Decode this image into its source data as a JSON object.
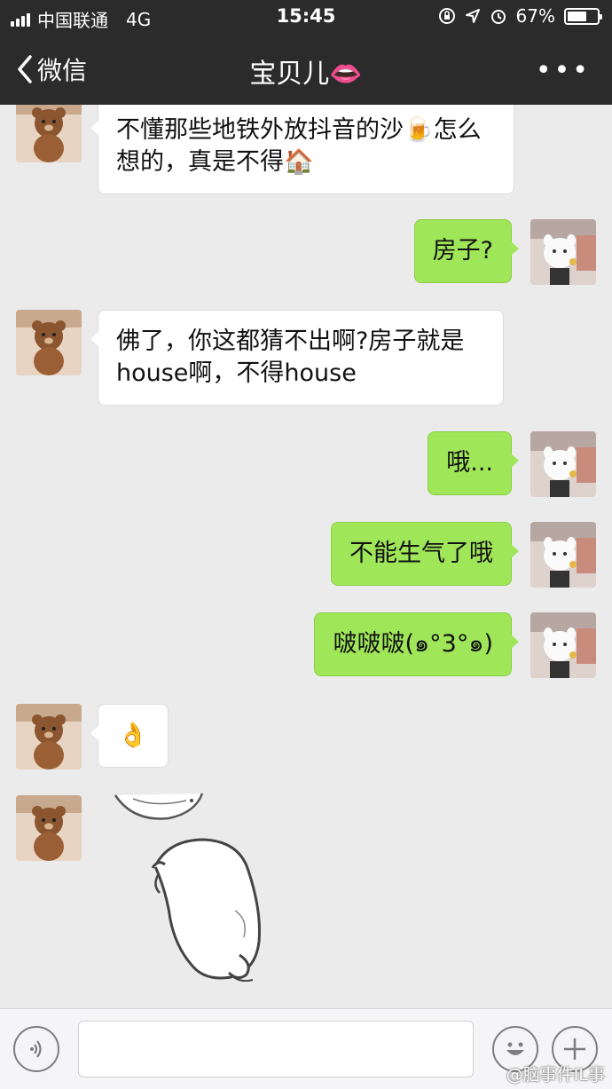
{
  "status_bar": {
    "carrier": "中国联通",
    "network": "4G",
    "time": "15:45",
    "battery_percent_text": "67%",
    "battery_level": 0.67
  },
  "nav": {
    "back_label": "微信",
    "title": "宝贝儿👄",
    "more_label": "•••"
  },
  "messages": [
    {
      "side": "in",
      "text": "不懂那些地铁外放抖音的沙🍺怎么想的，真是不得🏠"
    },
    {
      "side": "out",
      "text": "房子?"
    },
    {
      "side": "in",
      "text": "佛了，你这都猜不出啊?房子就是house啊，不得house"
    },
    {
      "side": "out",
      "text": "哦..."
    },
    {
      "side": "out",
      "text": "不能生气了哦"
    },
    {
      "side": "out",
      "text": "啵啵啵(๑°3°๑)"
    },
    {
      "side": "in",
      "text": "👌"
    },
    {
      "side": "in",
      "sticker": "white-dog-sticker"
    }
  ],
  "input_bar": {
    "voice_icon": "voice-icon",
    "emoji_icon": "emoji-icon",
    "plus_icon": "plus-icon"
  },
  "watermark": "@脑事件IL事",
  "colors": {
    "nav_bg": "#2b2b2b",
    "chat_bg": "#ebebeb",
    "bubble_out": "#9fe658",
    "bubble_in": "#ffffff"
  }
}
